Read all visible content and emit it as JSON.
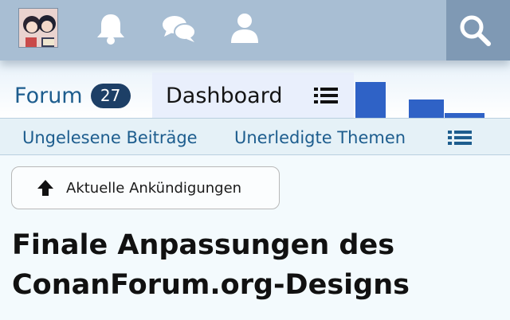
{
  "topbar": {
    "avatar_icon": "user-avatar",
    "icons": [
      "bell-icon",
      "comments-icon",
      "user-icon"
    ],
    "search_icon": "search-icon",
    "colors": {
      "bar": "#a8bed3",
      "search_bg": "#7f99b4",
      "icon": "#ffffff"
    }
  },
  "tabs": {
    "forum": {
      "label": "Forum",
      "badge": "27"
    },
    "dashboard": {
      "label": "Dashboard",
      "menu_icon": "list-icon"
    }
  },
  "subnav": {
    "items": [
      "Ungelesene Beiträge",
      "Unerledigte Themen"
    ],
    "menu_icon": "list-icon"
  },
  "announcement": {
    "label": "Aktuelle Ankündigungen",
    "icon": "arrow-up-icon"
  },
  "thread": {
    "title_line1": "Finale Anpassungen des",
    "title_line2": "ConanForum.org-Designs"
  },
  "colors": {
    "link": "#1d5d8e",
    "badge": "#1d3f66",
    "banner_accent": "#2f62c6"
  }
}
